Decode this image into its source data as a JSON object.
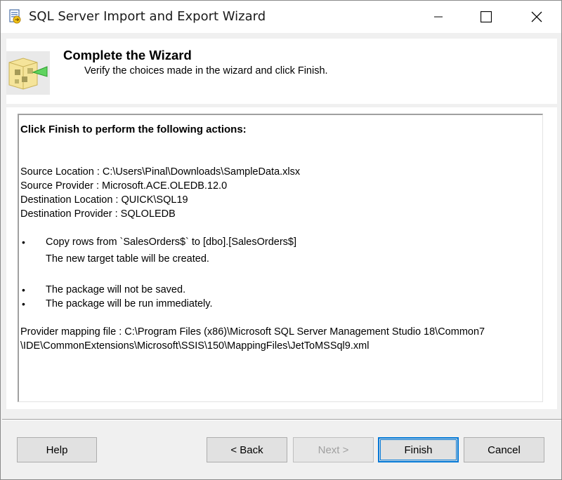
{
  "window": {
    "title": "SQL Server Import and Export Wizard"
  },
  "icons": {
    "app": "wizard-app-icon",
    "header": "package-wizard-icon",
    "minimize": "minimize-icon",
    "maximize": "maximize-icon",
    "close": "close-icon"
  },
  "header": {
    "title": "Complete the Wizard",
    "subtitle": "Verify the choices made in the wizard and click Finish."
  },
  "summary": {
    "heading": "Click Finish to perform the following actions:",
    "source_location": "Source Location : C:\\Users\\Pinal\\Downloads\\SampleData.xlsx",
    "source_provider": "Source Provider : Microsoft.ACE.OLEDB.12.0",
    "destination_location": "Destination Location : QUICK\\SQL19",
    "destination_provider": "Destination Provider : SQLOLEDB",
    "bullet_symbol": "•",
    "copy_rows": "Copy rows from `SalesOrders$` to [dbo].[SalesOrders$]",
    "new_table": "The new target table will be created.",
    "not_saved": "The package will not be saved.",
    "run_immediately": "The package will be run immediately.",
    "mapping_line1": "Provider mapping file : C:\\Program Files (x86)\\Microsoft SQL Server Management Studio 18\\Common7",
    "mapping_line2": "\\IDE\\CommonExtensions\\Microsoft\\SSIS\\150\\MappingFiles\\JetToMSSql9.xml"
  },
  "buttons": {
    "help": "Help",
    "back": "< Back",
    "next": "Next >",
    "finish": "Finish",
    "cancel": "Cancel"
  },
  "colors": {
    "accent": "#0078d7",
    "dialog_bg": "#f0f0f0",
    "disabled_text": "#a0a0a0"
  }
}
